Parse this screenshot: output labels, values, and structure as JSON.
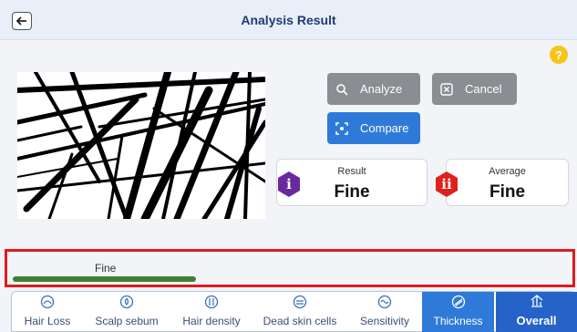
{
  "header": {
    "title": "Analysis Result",
    "back_icon": "arrow-left-icon"
  },
  "help": {
    "label": "?"
  },
  "buttons": {
    "analyze": "Analyze",
    "cancel": "Cancel",
    "compare": "Compare"
  },
  "result_card": {
    "label": "Result",
    "value": "Fine",
    "badge": "i"
  },
  "average_card": {
    "label": "Average",
    "value": "Fine",
    "badge": "ii"
  },
  "thickness_panel": {
    "label": "Fine",
    "level_percent": 33
  },
  "tabs": [
    {
      "label": "Hair Loss",
      "icon": "hair-loss-icon",
      "active": false
    },
    {
      "label": "Scalp sebum",
      "icon": "sebum-icon",
      "active": false
    },
    {
      "label": "Hair density",
      "icon": "density-icon",
      "active": false
    },
    {
      "label": "Dead skin cells",
      "icon": "skin-cells-icon",
      "active": false
    },
    {
      "label": "Sensitivity",
      "icon": "sensitivity-icon",
      "active": false
    },
    {
      "label": "Thickness",
      "icon": "thickness-icon",
      "active": true
    },
    {
      "label": "Overall",
      "icon": "overall-icon",
      "active": true
    }
  ],
  "colors": {
    "accent": "#2f7ad8",
    "highlight": "#e01b1b",
    "bar": "#3f7f3a",
    "badge_purple": "#6a2a9e",
    "badge_red": "#e0201b",
    "help": "#f5c518"
  }
}
